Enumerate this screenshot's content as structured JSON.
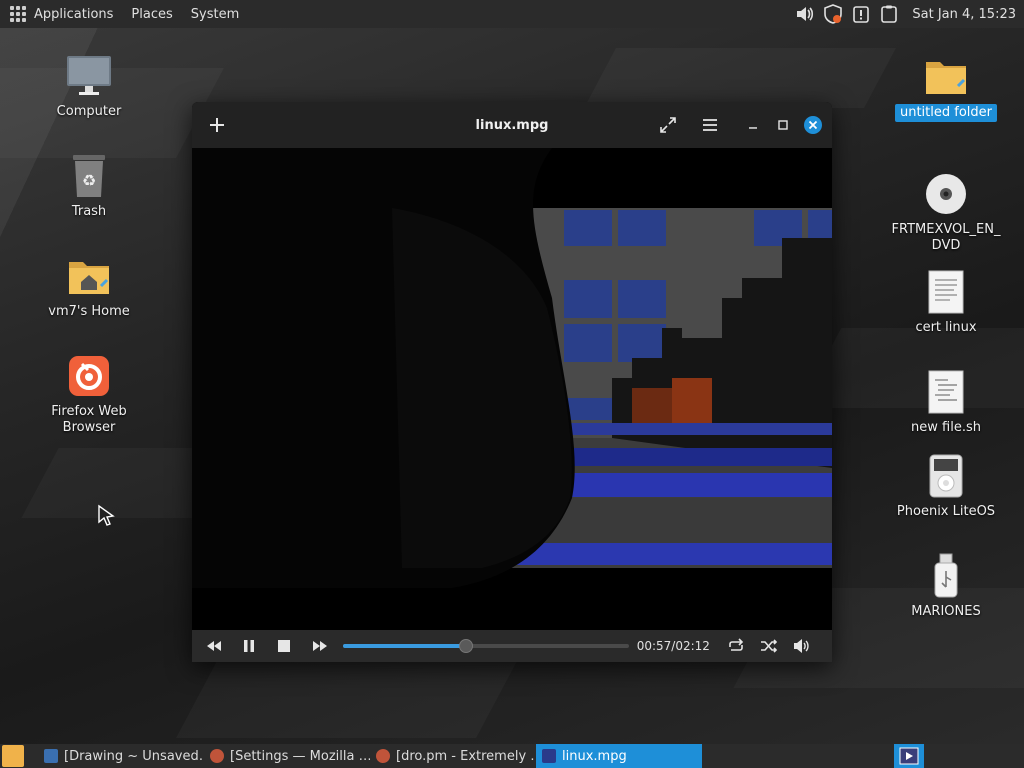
{
  "top_panel": {
    "menus": [
      "Applications",
      "Places",
      "System"
    ],
    "clock": "Sat Jan 4, 15:23"
  },
  "desktop_left": [
    {
      "label": "Computer",
      "icon": "computer-icon"
    },
    {
      "label": "Trash",
      "icon": "trash-icon"
    },
    {
      "label": "vm7's Home",
      "icon": "home-folder-icon"
    },
    {
      "label": "Firefox Web Browser",
      "icon": "firefox-icon"
    }
  ],
  "desktop_right": [
    {
      "label": "untitled folder",
      "icon": "folder-icon",
      "selected": true
    },
    {
      "label": "FRTMEXVOL_EN_\nDVD",
      "icon": "dvd-icon"
    },
    {
      "label": "cert linux",
      "icon": "text-file-icon"
    },
    {
      "label": "new file.sh",
      "icon": "script-file-icon"
    },
    {
      "label": "Phoenix LiteOS",
      "icon": "media-player-icon"
    },
    {
      "label": "MARIONES",
      "icon": "usb-drive-icon"
    }
  ],
  "player": {
    "title": "linux.mpg",
    "elapsed": "00:57",
    "duration": "02:12",
    "time_label": "00:57/02:12",
    "progress": 0.43
  },
  "taskbar": {
    "tasks": [
      {
        "label": "[Drawing ~ Unsaved…",
        "icon": "drawing-app-icon",
        "color": "#3a6fb0"
      },
      {
        "label": "[Settings — Mozilla …",
        "icon": "firefox-icon",
        "color": "#c0543a"
      },
      {
        "label": "[dro.pm - Extremely …",
        "icon": "firefox-icon",
        "color": "#c0543a"
      },
      {
        "label": "linux.mpg",
        "icon": "video-player-icon",
        "color": "#2a3a8a",
        "active": true
      }
    ]
  },
  "colors": {
    "accent": "#1e8fd8",
    "panel": "#2b2b2b"
  }
}
